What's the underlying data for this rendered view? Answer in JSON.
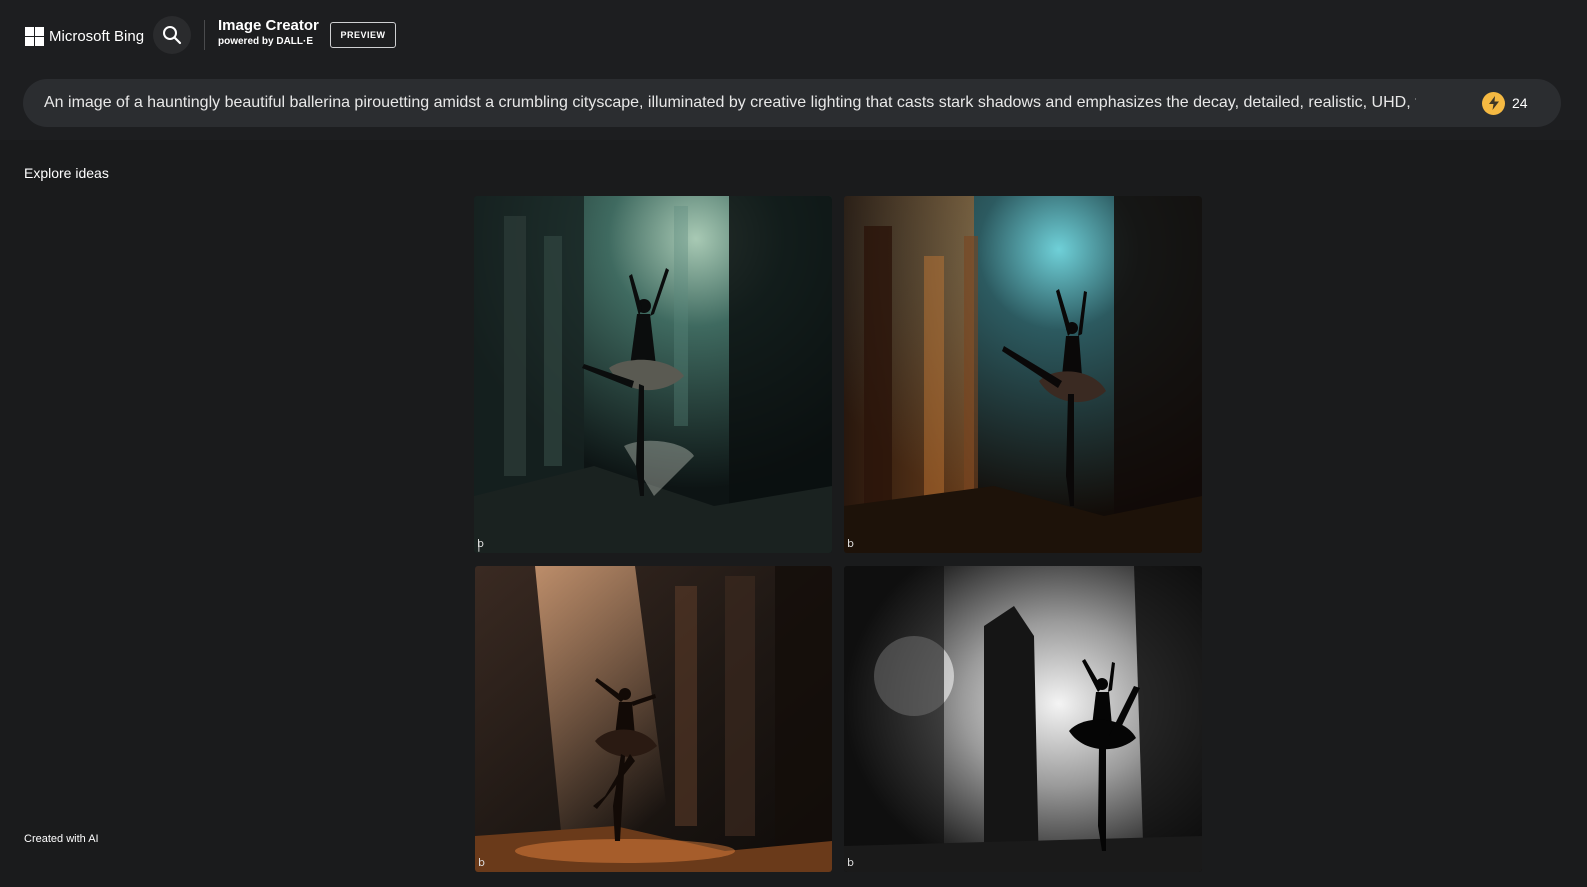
{
  "header": {
    "brand_label": "Microsoft Bing",
    "product_title": "Image Creator",
    "product_subtitle": "powered by DALL·E",
    "preview_badge": "PREVIEW",
    "search_icon": "search-icon",
    "logo_icon": "windows-logo-icon"
  },
  "prompt": {
    "text": "An image of a hauntingly beautiful ballerina pirouetting amidst a crumbling cityscape, illuminated by creative lighting that casts stark shadows and emphasizes the decay, detailed, realistic, UHD, tre",
    "boost_icon": "lightning-coin-icon",
    "boost_count": "24"
  },
  "sidebar": {
    "explore_label": "Explore ideas",
    "footer_label": "Created with AI"
  },
  "results": {
    "images": [
      {
        "name": "ballerina teal ruins",
        "watermark": "b"
      },
      {
        "name": "ballerina amber ruins",
        "watermark": "b"
      },
      {
        "name": "ballerina orange light",
        "watermark": "b"
      },
      {
        "name": "ballerina black and white",
        "watermark": "b"
      }
    ]
  },
  "colors": {
    "background": "#1a1b1c",
    "header": "#1d1e20",
    "prompt_bar": "#2b2d30",
    "coin": "#f5b942"
  }
}
